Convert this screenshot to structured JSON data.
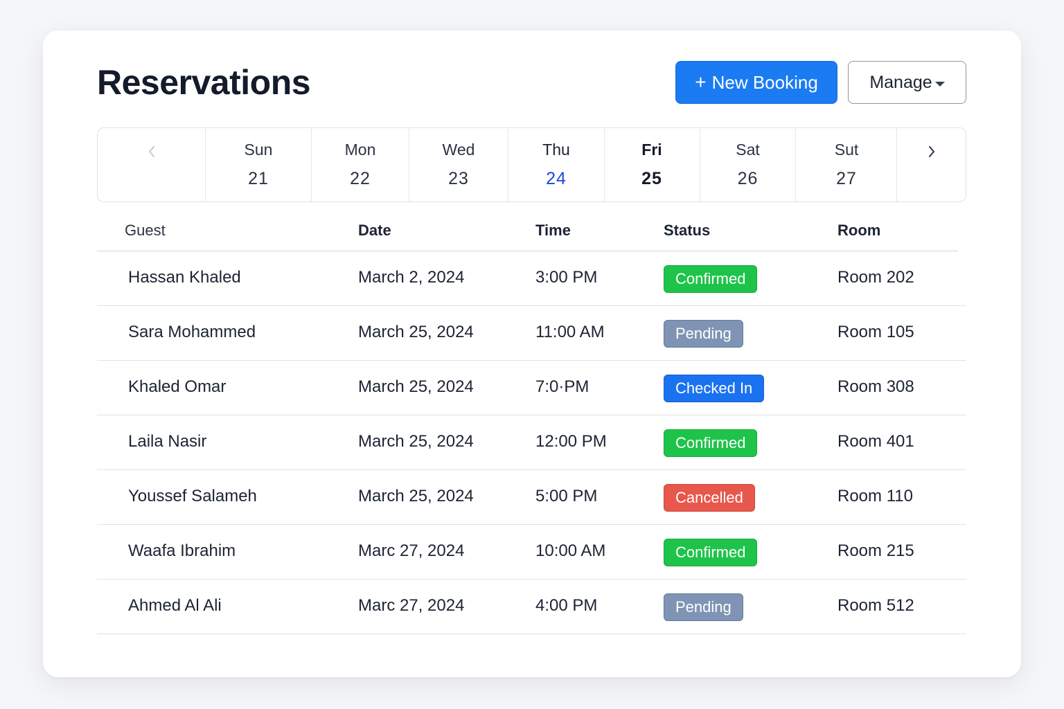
{
  "page": {
    "title": "Reservations"
  },
  "toolbar": {
    "new_booking_plus": "+",
    "new_booking_label": "New Booking",
    "manage_label": "Manage"
  },
  "week": {
    "prev_icon": "chevron-left-icon",
    "next_icon": "chevron-right-icon",
    "days": [
      {
        "name": "Sun",
        "num": "21"
      },
      {
        "name": "Mon",
        "num": "22"
      },
      {
        "name": "Wed",
        "num": "23"
      },
      {
        "name": "Thu",
        "num": "24"
      },
      {
        "name": "Fri",
        "num": "25"
      },
      {
        "name": "Sat",
        "num": "26"
      },
      {
        "name": "Sut",
        "num": "27"
      }
    ]
  },
  "table": {
    "headers": {
      "guest": "Guest",
      "date": "Date",
      "time": "Time",
      "status": "Status",
      "room": "Room"
    },
    "rows": [
      {
        "guest": "Hassan Khaled",
        "date": "March 2, 2024",
        "time": "3:00 PM",
        "status": "Confirmed",
        "room": "Room 202"
      },
      {
        "guest": "Sara Mohammed",
        "date": "March 25, 2024",
        "time": "11:00 AM",
        "status": "Pending",
        "room": "Room 105"
      },
      {
        "guest": "Khaled Omar",
        "date": "March 25, 2024",
        "time": "7:0·PM",
        "status": "Checked In",
        "room": "Room 308"
      },
      {
        "guest": "Laila Nasir",
        "date": "March 25, 2024",
        "time": "12:00 PM",
        "status": "Confirmed",
        "room": "Room 401"
      },
      {
        "guest": "Youssef Salameh",
        "date": "March 25, 2024",
        "time": "5:00 PM",
        "status": "Cancelled",
        "room": "Room 110"
      },
      {
        "guest": "Waafa Ibrahim",
        "date": "Marc 27, 2024",
        "time": "10:00 AM",
        "status": "Confirmed",
        "room": "Room 215"
      },
      {
        "guest": "Ahmed Al Ali",
        "date": "Marc 27, 2024",
        "time": "4:00 PM",
        "status": "Pending",
        "room": "Room 512"
      }
    ]
  },
  "colors": {
    "primary": "#1b7bf2",
    "today": "#1f47d6",
    "confirmed": "#1ec44a",
    "pending": "#7f94b4",
    "checked_in": "#1b72f0",
    "cancelled": "#e8574c"
  }
}
